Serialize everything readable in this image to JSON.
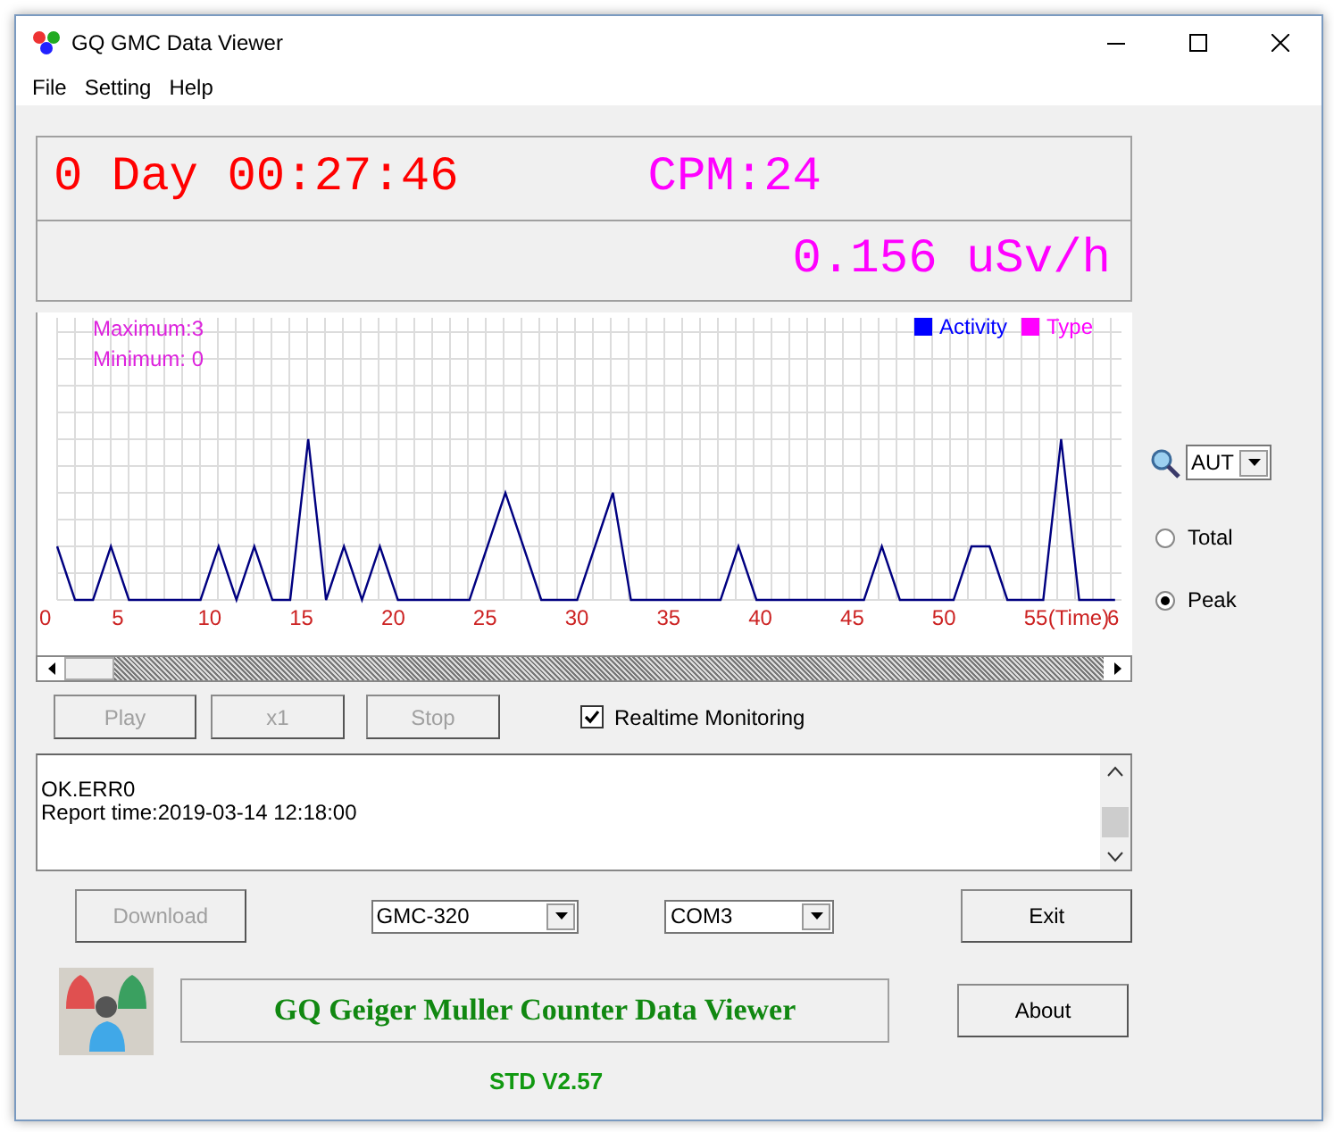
{
  "window": {
    "title": "GQ GMC Data Viewer"
  },
  "menu": [
    "File",
    "Setting",
    "Help"
  ],
  "display": {
    "elapsed": "0 Day 00:27:46",
    "cpm": "CPM:24",
    "dose": "0.156 uSv/h"
  },
  "chart": {
    "maximum": "Maximum:3",
    "minimum": "Minimum: 0",
    "legend": [
      {
        "label": "Activity",
        "color": "#0000ff"
      },
      {
        "label": "Type",
        "color": "#ff00ff"
      }
    ],
    "x_labels": [
      "0",
      "5",
      "10",
      "15",
      "20",
      "25",
      "30",
      "35",
      "40",
      "45",
      "50",
      "55"
    ],
    "time_label": "(Time)",
    "last_label": "6"
  },
  "playback": [
    {
      "label": "Play",
      "disabled": true
    },
    {
      "label": "x1",
      "disabled": true
    },
    {
      "label": "Stop",
      "disabled": true
    }
  ],
  "realtime": {
    "label": "Realtime Monitoring",
    "checked": true
  },
  "log": [
    "OK.ERR0",
    "Report time:2019-03-14 12:18:00"
  ],
  "scale": {
    "value": "AUT"
  },
  "modes": [
    {
      "label": "Total",
      "selected": false
    },
    {
      "label": "Peak",
      "selected": true
    }
  ],
  "download": {
    "label": "Download",
    "disabled": true
  },
  "device": "GMC-320",
  "port": "COM3",
  "actions": [
    "Exit",
    "About"
  ],
  "banner": "GQ Geiger Muller Counter Data Viewer",
  "version": "STD V2.57"
}
